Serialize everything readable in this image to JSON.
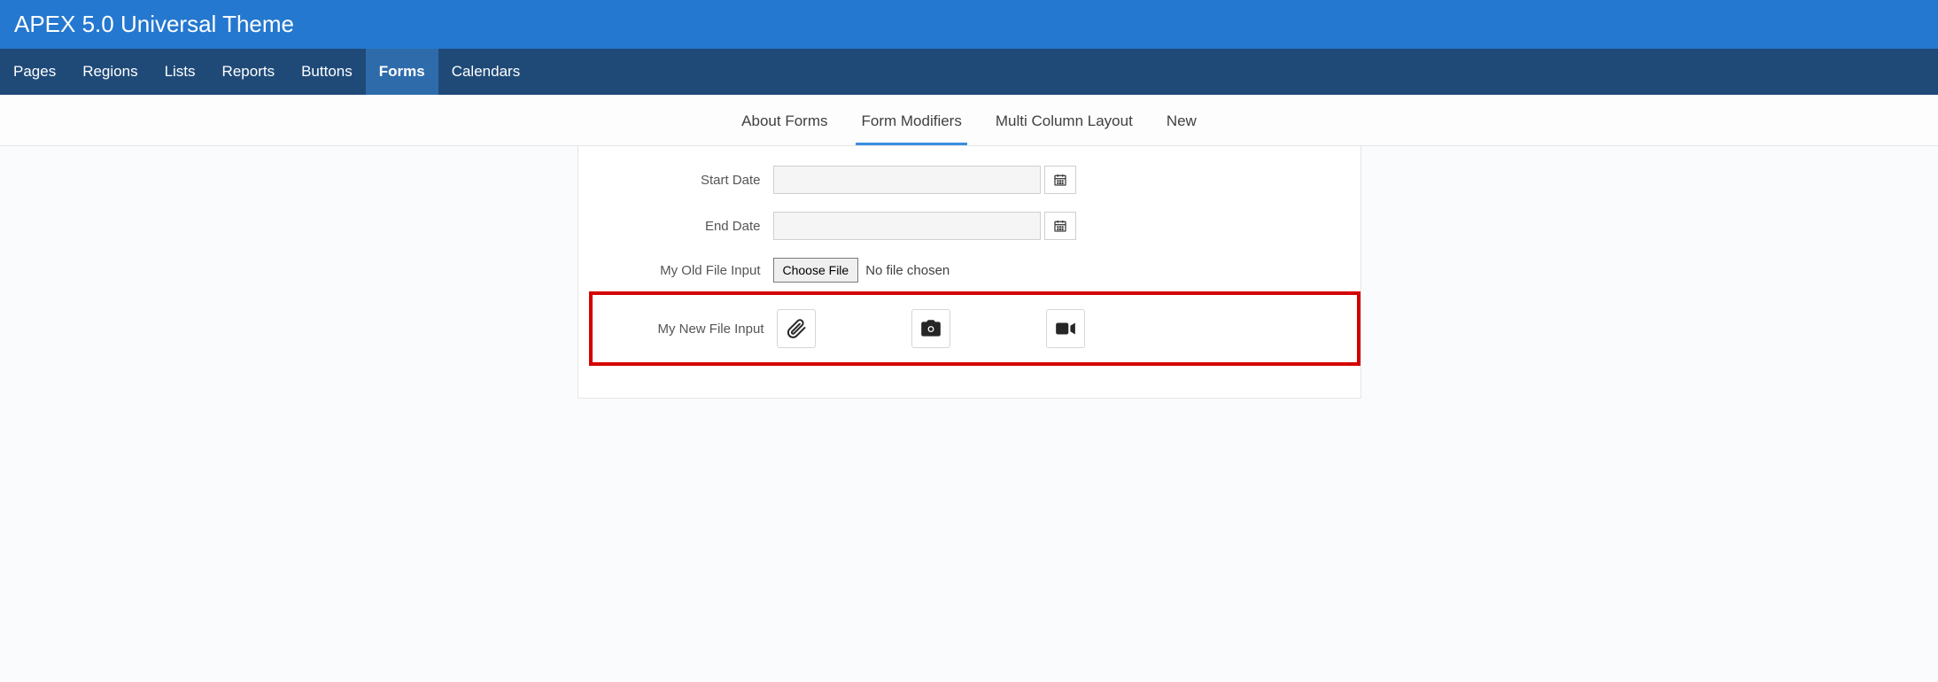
{
  "header": {
    "title": "APEX 5.0 Universal Theme"
  },
  "primary_nav": {
    "items": [
      {
        "label": "Pages",
        "active": false
      },
      {
        "label": "Regions",
        "active": false
      },
      {
        "label": "Lists",
        "active": false
      },
      {
        "label": "Reports",
        "active": false
      },
      {
        "label": "Buttons",
        "active": false
      },
      {
        "label": "Forms",
        "active": true
      },
      {
        "label": "Calendars",
        "active": false
      }
    ]
  },
  "sub_nav": {
    "items": [
      {
        "label": "About Forms",
        "active": false
      },
      {
        "label": "Form Modifiers",
        "active": true
      },
      {
        "label": "Multi Column Layout",
        "active": false
      },
      {
        "label": "New",
        "active": false
      }
    ]
  },
  "form": {
    "start_date": {
      "label": "Start Date",
      "value": ""
    },
    "end_date": {
      "label": "End Date",
      "value": ""
    },
    "old_file": {
      "label": "My Old File Input",
      "button": "Choose File",
      "status": "No file chosen"
    },
    "new_file": {
      "label": "My New File Input"
    }
  }
}
